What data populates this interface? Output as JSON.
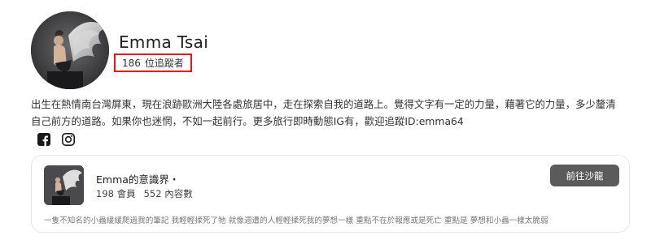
{
  "profile": {
    "name": "Emma Tsai",
    "followers_count": "186",
    "followers_label": "位追蹤者",
    "avatar_icon": "winged-figure-photo"
  },
  "bio": {
    "line1": "出生在熱情南台灣屏東，現在浪跡歐洲大陸各處旅居中，走在探索自我的道路上。覺得文字有一定的力量，藉著它的力量，多少釐清",
    "line2": "自己前方的道路。如果你也迷惘，不如一起前行。更多旅行即時動態IG有，歡迎追蹤ID:emma64"
  },
  "social": [
    {
      "icon": "facebook-icon"
    },
    {
      "icon": "instagram-icon"
    }
  ],
  "salon": {
    "title": "Emma的意識界・",
    "members": "198 會員",
    "posts": "552 內容數",
    "button_label": "前往沙龍",
    "description": "一隻不知名的小蟲緩緩爬過我的筆記 我輕輕揉死了牠 就像週遭的人輕輕揉死我的夢想一樣 重點不在於報應或是死亡 重點是 夢想和小蟲一樣太脆弱"
  },
  "colors": {
    "highlight_border": "#e8141c",
    "button_bg": "#5b5b5b",
    "card_border": "#e6e6e6"
  }
}
